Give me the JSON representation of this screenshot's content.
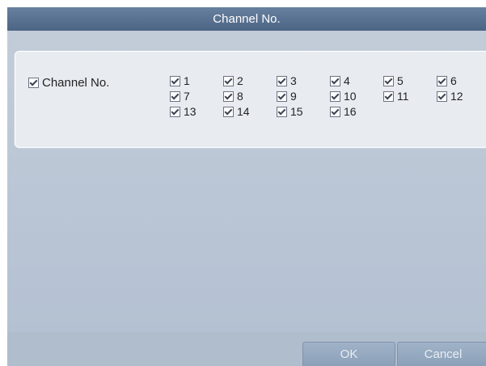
{
  "dialog": {
    "title": "Channel No."
  },
  "channel_select": {
    "label": "Channel No.",
    "checked": true,
    "channels": [
      {
        "label": "1",
        "checked": true
      },
      {
        "label": "2",
        "checked": true
      },
      {
        "label": "3",
        "checked": true
      },
      {
        "label": "4",
        "checked": true
      },
      {
        "label": "5",
        "checked": true
      },
      {
        "label": "6",
        "checked": true
      },
      {
        "label": "7",
        "checked": true
      },
      {
        "label": "8",
        "checked": true
      },
      {
        "label": "9",
        "checked": true
      },
      {
        "label": "10",
        "checked": true
      },
      {
        "label": "11",
        "checked": true
      },
      {
        "label": "12",
        "checked": true
      },
      {
        "label": "13",
        "checked": true
      },
      {
        "label": "14",
        "checked": true
      },
      {
        "label": "15",
        "checked": true
      },
      {
        "label": "16",
        "checked": true
      }
    ]
  },
  "footer": {
    "ok_label": "OK",
    "cancel_label": "Cancel"
  }
}
